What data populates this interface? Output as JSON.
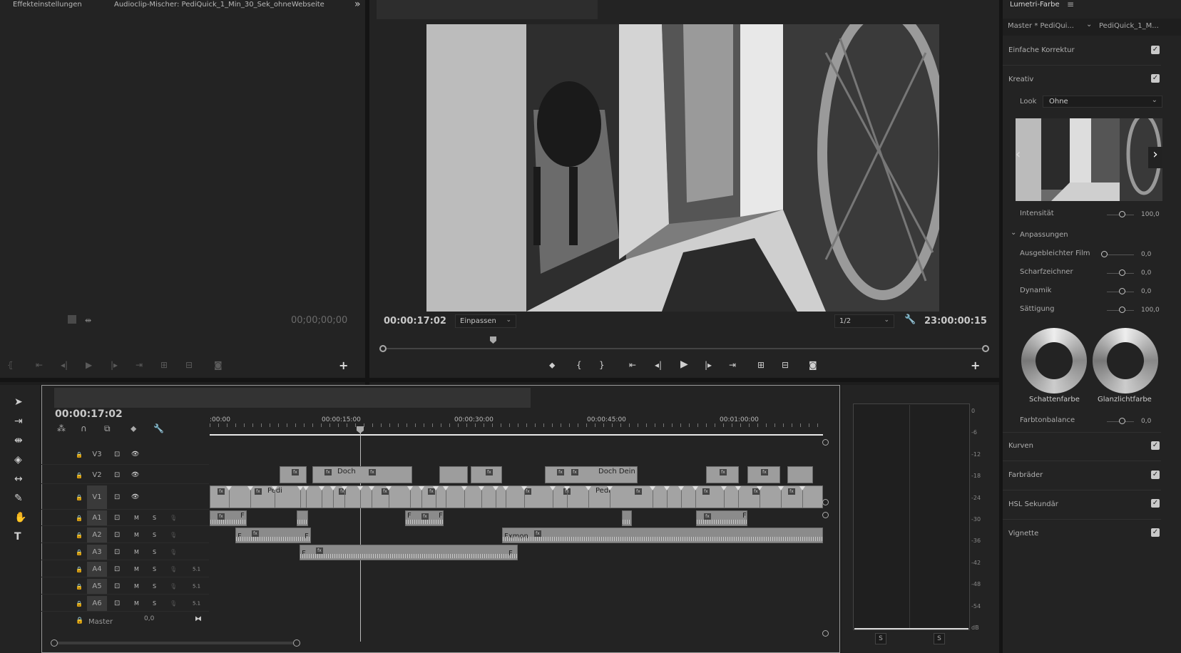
{
  "source_panel": {
    "tab_effect": "Effekteinstellungen",
    "tab_audio": "Audioclip-Mischer: PediQuick_1_Min_30_Sek_ohneWebseite",
    "overflow": "»",
    "timecode": "00;00;00;00"
  },
  "program": {
    "current_time": "00:00:17:02",
    "fit_label": "Einpassen",
    "resolution": "1/2",
    "duration": "23:00:00:15"
  },
  "lumetri": {
    "title": "Lumetri-Farbe",
    "menu": "≡",
    "master": "Master * PediQui...",
    "clip": "PediQuick_1_M...",
    "basic": "Einfache Korrektur",
    "creative": "Kreativ",
    "look_label": "Look",
    "look_value": "Ohne",
    "intensity_label": "Intensität",
    "intensity_value": "100,0",
    "adjust": "Anpassungen",
    "faded_label": "Ausgebleichter Film",
    "faded_value": "0,0",
    "sharpen_label": "Scharfzeichner",
    "sharpen_value": "0,0",
    "vibrance_label": "Dynamik",
    "vibrance_value": "0,0",
    "saturation_label": "Sättigung",
    "saturation_value": "100,0",
    "shadow_label": "Schattenfarbe",
    "highlight_label": "Glanzlichtfarbe",
    "tint_label": "Farbtonbalance",
    "tint_value": "0,0",
    "curves": "Kurven",
    "wheels": "Farbräder",
    "hsl": "HSL Sekundär",
    "vignette": "Vignette"
  },
  "timeline": {
    "timecode": "00:00:17:02",
    "ruler": [
      ":00:00",
      "00:00:15:00",
      "00:00:30:00",
      "00:00:45:00",
      "00:01:00:00"
    ],
    "tracks": [
      "V3",
      "V2",
      "V1",
      "A1",
      "A2",
      "A3",
      "A4",
      "A5",
      "A6"
    ],
    "mute": "M",
    "solo": "S",
    "channel": "5.1",
    "master_label": "Master",
    "master_value": "0,0",
    "clip_v2_a": "Doch",
    "clip_v2_b": "Doch Dein",
    "clip_v1_a": "Pedi",
    "clip_v1_b": "Pedi",
    "clip_a2": "Fxmon",
    "fx": "fx",
    "f": "F"
  },
  "meters": {
    "scale": [
      "0",
      "-6",
      "-12",
      "-18",
      "-24",
      "-30",
      "-36",
      "-42",
      "-48",
      "-54",
      "dB"
    ],
    "solo_left": "S",
    "solo_right": "S"
  }
}
